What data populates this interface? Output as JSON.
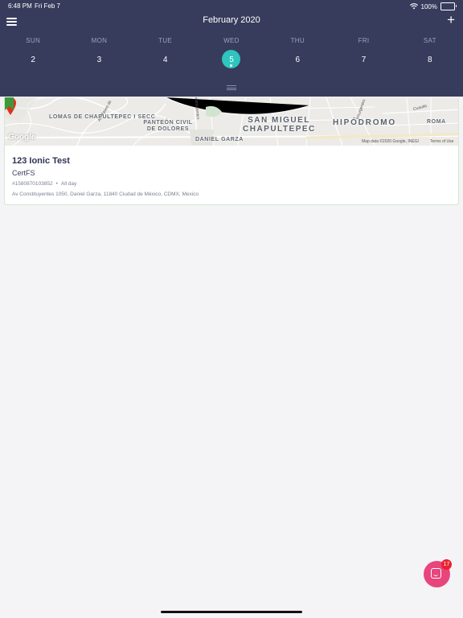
{
  "status_bar": {
    "time": "6:48 PM",
    "date": "Fri Feb 7",
    "battery": "100%",
    "battery_level": 1.0
  },
  "header": {
    "title": "February 2020",
    "menu_icon": "hamburger-menu-icon",
    "add_icon": "plus-icon",
    "background_color": "#373c5c"
  },
  "week": {
    "days": [
      {
        "weekday": "SUN",
        "date": "2"
      },
      {
        "weekday": "MON",
        "date": "3"
      },
      {
        "weekday": "TUE",
        "date": "4"
      },
      {
        "weekday": "WED",
        "date": "5"
      },
      {
        "weekday": "THU",
        "date": "6"
      },
      {
        "weekday": "FRI",
        "date": "7"
      },
      {
        "weekday": "SAT",
        "date": "8"
      }
    ],
    "selected_date": "5",
    "selected_color": "#2dc5be"
  },
  "map": {
    "labels": {
      "lomas": "LOMAS DE CHAPULTEPEC I SECC",
      "panteon": "PANTEÓN CIVIL DE DOLORES",
      "san_miguel": "SAN MIGUEL CHAPULTEPEC",
      "hipodromo": "HIPÓDROMO",
      "roma": "ROMA",
      "daniel_garza": "DANIEL GARZA",
      "street_reforma": "Av. Paseo de",
      "street_constituyentes": "Constituyentes",
      "street_insurgentes": "Insurgentes",
      "street_cuauhtla": "Cuautla"
    },
    "google_logo": "Google",
    "attribution": "Map data ©2020 Google, INEGI",
    "terms": "Terms of Use",
    "pin_icon": "map-pin-icon",
    "bookmark_icon": "bookmark-icon"
  },
  "event": {
    "title": "123 Ionic Test",
    "organization": "CertFS",
    "id": "#1580870103852",
    "separator": "•",
    "time": "All day",
    "address": "Av Constituyentes 1050, Daniel Garza, 11840 Ciudad de México, CDMX, Mexico"
  },
  "chat": {
    "icon": "chat-icon",
    "badge_count": "17",
    "color": "#e8457c"
  }
}
